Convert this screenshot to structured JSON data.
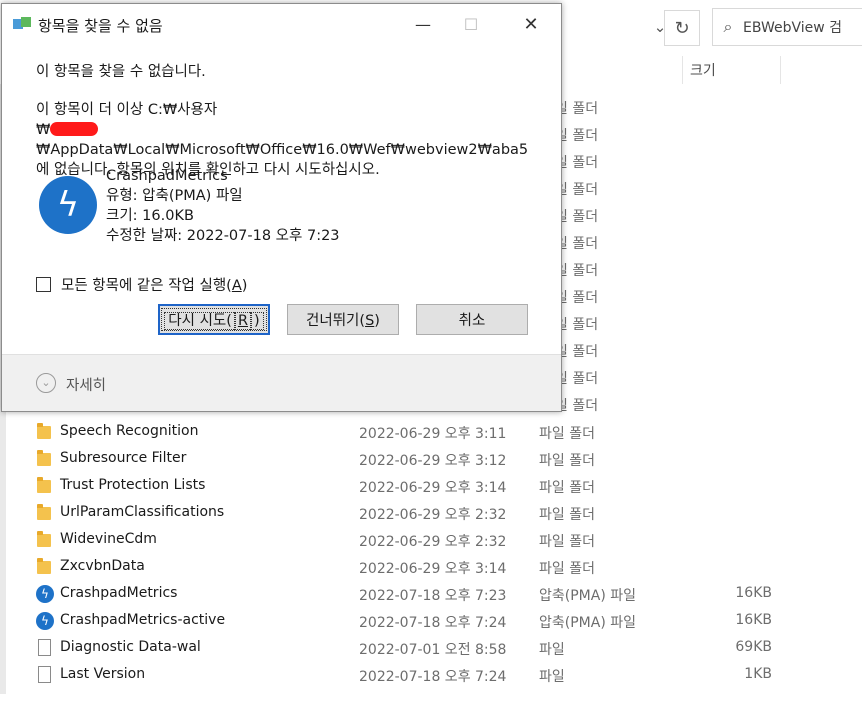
{
  "explorer": {
    "search_placeholder": "EBWebView 검",
    "columns": {
      "size": "크기"
    },
    "hidden_rows": [
      {
        "type": "일 폴더"
      },
      {
        "type": "일 폴더"
      },
      {
        "type": "일 폴더"
      },
      {
        "type": "일 폴더"
      },
      {
        "type": "일 폴더"
      },
      {
        "type": "일 폴더"
      },
      {
        "type": "일 폴더"
      },
      {
        "type": "일 폴더"
      },
      {
        "type": "일 폴더"
      },
      {
        "type": "일 폴더"
      },
      {
        "type": "일 폴더"
      },
      {
        "type": "일 폴더"
      }
    ],
    "rows": [
      {
        "icon": "folder-icon",
        "name": "Speech Recognition",
        "date": "2022-06-29 오후 3:11",
        "type": "파일 폴더",
        "size": ""
      },
      {
        "icon": "folder-icon",
        "name": "Subresource Filter",
        "date": "2022-06-29 오후 3:12",
        "type": "파일 폴더",
        "size": ""
      },
      {
        "icon": "folder-icon",
        "name": "Trust Protection Lists",
        "date": "2022-06-29 오후 3:14",
        "type": "파일 폴더",
        "size": ""
      },
      {
        "icon": "folder-icon",
        "name": "UrlParamClassifications",
        "date": "2022-06-29 오후 2:32",
        "type": "파일 폴더",
        "size": ""
      },
      {
        "icon": "folder-icon",
        "name": "WidevineCdm",
        "date": "2022-06-29 오후 2:32",
        "type": "파일 폴더",
        "size": ""
      },
      {
        "icon": "folder-icon",
        "name": "ZxcvbnData",
        "date": "2022-06-29 오후 3:14",
        "type": "파일 폴더",
        "size": ""
      },
      {
        "icon": "crashpad-icon",
        "name": "CrashpadMetrics",
        "date": "2022-07-18 오후 7:23",
        "type": "압축(PMA) 파일",
        "size": "16KB"
      },
      {
        "icon": "crashpad-icon",
        "name": "CrashpadMetrics-active",
        "date": "2022-07-18 오후 7:24",
        "type": "압축(PMA) 파일",
        "size": "16KB"
      },
      {
        "icon": "file-icon",
        "name": "Diagnostic Data-wal",
        "date": "2022-07-01 오전 8:58",
        "type": "파일",
        "size": "69KB"
      },
      {
        "icon": "file-icon",
        "name": "Last Version",
        "date": "2022-07-18 오후 7:24",
        "type": "파일",
        "size": "1KB"
      }
    ]
  },
  "dialog": {
    "title": "항목을 찾을 수 없음",
    "heading": "이 항목을 찾을 수 없습니다.",
    "msg_line1": "이 항목이 더 이상 C:₩사용자",
    "msg_line2_prefix": "₩",
    "msg_line2_rest": "₩AppData₩Local₩Microsoft₩Office₩16.0₩Wef₩webview2₩aba5",
    "msg_line3": "에 없습니다. 항목의 위치를 확인하고 다시 시도하십시오.",
    "file_name": "CrashpadMetrics",
    "file_type": "유형: 압축(PMA) 파일",
    "file_size": "크기: 16.0KB",
    "file_modified": "수정한 날짜: 2022-07-18 오후 7:23",
    "checkbox_label_prefix": "모든 항목에 같은 작업 실행(",
    "checkbox_label_key": "A",
    "checkbox_label_suffix": ")",
    "retry_prefix": "다시 시도(",
    "retry_key": "R",
    "retry_suffix": ")",
    "skip_prefix": "건너뛰기(",
    "skip_key": "S",
    "skip_suffix": ")",
    "cancel_label": "취소",
    "details_label": "자세히"
  }
}
